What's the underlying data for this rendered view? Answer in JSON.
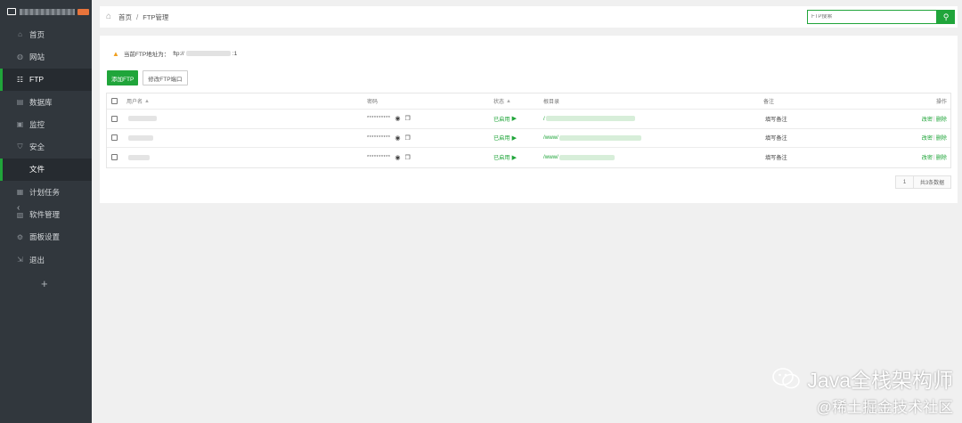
{
  "sidebar": {
    "items": [
      {
        "label": "首页",
        "icon": "home-icon",
        "glyph": "⌂"
      },
      {
        "label": "网站",
        "icon": "globe-icon",
        "glyph": "◍"
      },
      {
        "label": "FTP",
        "icon": "ftp-icon",
        "glyph": "☷"
      },
      {
        "label": "数据库",
        "icon": "database-icon",
        "glyph": "▤"
      },
      {
        "label": "监控",
        "icon": "monitor-icon",
        "glyph": "▣"
      },
      {
        "label": "安全",
        "icon": "shield-icon",
        "glyph": "⛉"
      },
      {
        "label": "文件",
        "icon": "",
        "glyph": ""
      },
      {
        "label": "计划任务",
        "icon": "calendar-icon",
        "glyph": "▦"
      },
      {
        "label": "软件管理",
        "icon": "apps-icon",
        "glyph": "▧"
      },
      {
        "label": "面板设置",
        "icon": "gear-icon",
        "glyph": "⚙"
      },
      {
        "label": "退出",
        "icon": "logout-icon",
        "glyph": "⇲"
      }
    ],
    "active_index": 2,
    "add_glyph": "+",
    "collapse_glyph": "‹"
  },
  "breadcrumb": {
    "home": "首页",
    "separator": "/",
    "current": "FTP管理"
  },
  "search": {
    "placeholder": "FTP搜索",
    "button_glyph": "⚲"
  },
  "notice": {
    "label": "当前FTP地址为：",
    "address_prefix": "ftp://",
    "address_suffix": ":1"
  },
  "buttons": {
    "add_ftp": "添加FTP",
    "change_port": "修改FTP端口"
  },
  "table": {
    "headers": {
      "username": "用户名",
      "password": "密码",
      "status": "状态",
      "root": "根目录",
      "remark": "备注",
      "actions": "操作"
    },
    "rows": [
      {
        "password": "**********",
        "status": "已启用",
        "path_prefix": "/",
        "remark": "填写备注",
        "edit": "改密",
        "delete": "删除"
      },
      {
        "password": "**********",
        "status": "已启用",
        "path_prefix": "/www/",
        "remark": "填写备注",
        "edit": "改密",
        "delete": "删除"
      },
      {
        "password": "**********",
        "status": "已启用",
        "path_prefix": "/www/",
        "remark": "填写备注",
        "edit": "改密",
        "delete": "删除"
      }
    ]
  },
  "pagination": {
    "page": "1",
    "total": "共3条数据"
  },
  "watermark": {
    "line1": "Java全栈架构师",
    "line2": "@稀土掘金技术社区"
  },
  "colors": {
    "accent": "#20a53a",
    "sidebar_bg": "#31373d",
    "warning": "#f0a020"
  }
}
